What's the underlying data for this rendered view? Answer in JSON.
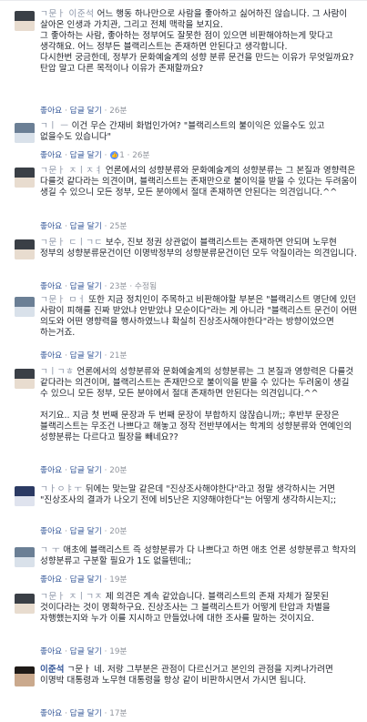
{
  "actions": {
    "like": "좋아요",
    "reply": "답글 달기",
    "edited": "수정됨"
  },
  "comments": [
    {
      "name": "ㄱ문ㅏ 이준석",
      "text": "어느 행동 하나만으로 사람을 좋아하고 싫어하진 않습니다. 그 사람이 살아온 인생과 가치관, 그리고 전체 맥락을 보지요.\n그 좋아하는 사람, 좋아하는 정부여도 잘못한 점이 있으면 비판해야하는게 맞다고 생각해요. 어느 정부든 블랙리스트는 존재하면 안된다고 생각합니다.\n다시한번 궁금한데, 정부가 문화예술계의 성향 분류 문건을 만드는 이유가 무엇일까요? 탄압 말고 다른 목적이나 이유가 존재할까요?",
      "time": "26분",
      "likes": ""
    },
    {
      "name": "ㄱㅣ ㅡ",
      "text": "이건 무슨 간재비 화법인가여? \"블랙리스트의 불이익은 있을수도 있고 없을수도 있습니다\"",
      "time": "26분",
      "likes": "1"
    },
    {
      "name": "ㄱ문ㅏ ㅈㅣㅈㅕ",
      "text": "언론에서의 성향분류와 문화예술계의 성향분류는 그 본질과 영향력은 다를것 같다라는 의견이며, 블랙리스트는 존재만으로 불이익을 받을 수 있다는 두려움이 생길 수 있으니 모든 정부, 모든 분야에서 절대 존재하면 안된다는 의견입니다.^^",
      "time": "25분",
      "likes": ""
    },
    {
      "name": "ㄱ문ㅏ ㄷㅣㄱㄷ",
      "text": "보수, 진보 정권 상관없이 블랙리스트는 존재하면 안되며 노무현 정부의 성향분류문건이던 이명박정부의 성향분류문건이던 모두 악질이라는 의견입니다.",
      "time": "23분",
      "likes": "",
      "edited": true
    },
    {
      "name": "ㄱ문ㅏ ㅁㅓ",
      "text": "또한 지금 정치인이 주목하고 비판해야할 부분은 \"블랙리스트 명단에 있던 사람이 피해를 진짜 받았냐 안받았냐 모순이다\"라는 게 아니라 \"블랙리스트 문건이 어떤 의도와 어떤 영향력을 행사하였느냐 확실히 진상조사해야한다\"라는 방향이었으면 하는거죠.",
      "time": "21분",
      "likes": ""
    },
    {
      "name": "ㄱㅣㄱㅎ",
      "text": "언론에서의 성향분류와 문화예술계의 성향분류는 그 본질과 영향력은 다를것 같다라는 의견이며, 블랙리스트는 존재만으로 불이익을 받을 수 있다는 두려움이 생길 수 있으니 모든 정부, 모든 분야에서 절대 존재하면 안된다는 의견입니다.^^\n\n저기요.. 지금 첫 번째 문장과 두 번째 문장이 부합하지 않잖습니까;; 후반부 문장은 블랙리스트는 무조건 나쁘다고 해놓고 정작 전반부에서는 학계의 성향분류와 연예인의 성향분류는 다르다고 필장을 빼네요??",
      "time": "20분",
      "likes": ""
    },
    {
      "name": "ㄱㅏㅇㅑㅜ",
      "text": "뒤에는 맞는말 같은데 \"진상조사해야한다\"라고 정말 생각하시는 거면 \"진상조사의 결과가 나오기 전에 비5난은 지양해야한다\"는 어떻게 생각하시는지;;",
      "time": "20분",
      "likes": ""
    },
    {
      "name": "ㄱ ㅜ",
      "text": "애초에 블랙리스트 즉 성향분류가 다 나쁘다고 하면 애초 언론 성향분류고 학자의 성향분류고 구분할 필요가 1도 없을텐데;;",
      "time": "19분",
      "likes": ""
    },
    {
      "name": "ㄱ문ㅏ ㅈㅣㄱㅈ",
      "text": "제 의견은 계속 같았습니다. 블랙리스트의 존재 자체가 잘못된 것이다라는 것이 명확하구요. 진상조사는 그 블랙리스트가 어떻게 탄압과 차별을 자행했는지와 누가 이를 지시하고 만들었나에 대한 조사를 말하는 것이지요.",
      "time": "19분",
      "likes": ""
    },
    {
      "name": "이준석",
      "text": "ㄱ문ㅏ 네. 저랑 그부분은 관점이 다르신거고 본인의 관점을 지켜나가려면 이명박 대통령과 노무현 대통령을 항상 같이 비판하시면서 가시면 됩니다.",
      "time": "17분",
      "likes": ""
    }
  ]
}
